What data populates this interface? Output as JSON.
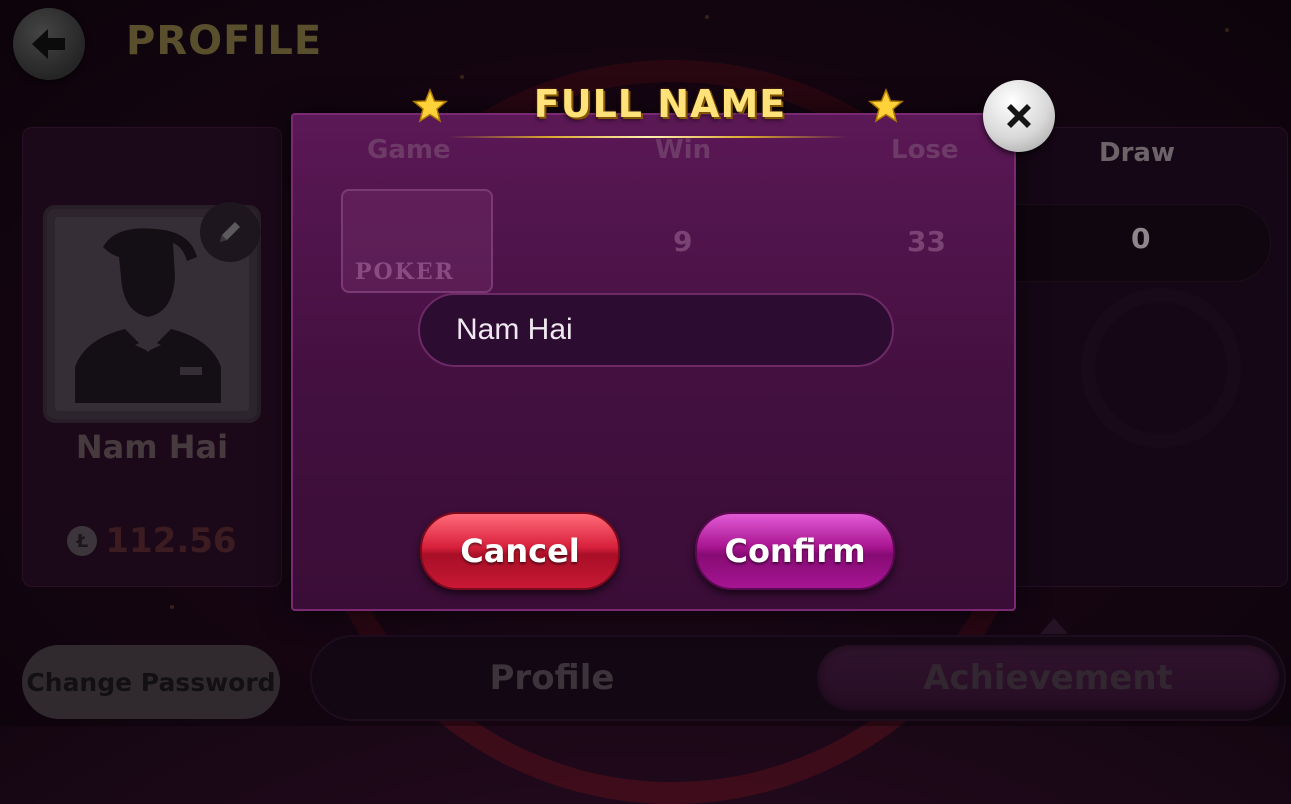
{
  "header": {
    "title": "PROFILE",
    "back_icon": "arrow-left-icon"
  },
  "profile_card": {
    "name": "Nam Hai",
    "balance": "112.56",
    "coin_symbol": "Ł",
    "edit_icon": "pencil-icon"
  },
  "stats_table": {
    "columns": [
      "Game",
      "Win",
      "Lose",
      "Draw"
    ],
    "rows": [
      {
        "game": "POKER",
        "win": "9",
        "lose": "33",
        "draw": "0"
      }
    ]
  },
  "bottom": {
    "change_password_label": "Change Password",
    "tabs": [
      {
        "label": "Profile",
        "active": false
      },
      {
        "label": "Achievement",
        "active": true
      }
    ]
  },
  "modal": {
    "title": "FULL NAME",
    "input_value": "Nam Hai",
    "cancel_label": "Cancel",
    "confirm_label": "Confirm",
    "close_icon": "close-icon",
    "star_icon": "star-icon"
  },
  "colors": {
    "title_gold": "#ffe37a",
    "cancel_red": "#d8203c",
    "confirm_purple": "#a8148f",
    "modal_bg": "#4a1245"
  }
}
